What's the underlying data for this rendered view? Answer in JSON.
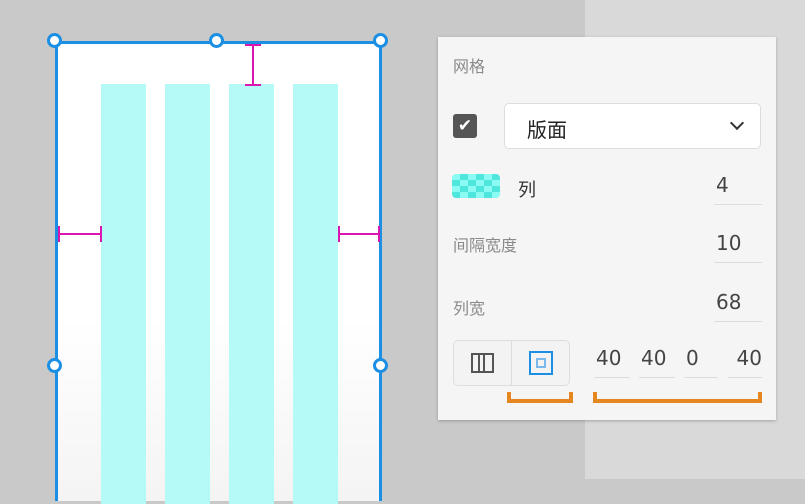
{
  "panel": {
    "title": "网格",
    "enabled": true,
    "layout_select": "版面",
    "columns_label": "列",
    "columns_value": "4",
    "gutter_label": "间隔宽度",
    "gutter_value": "10",
    "col_width_label": "列宽",
    "col_width_value": "68",
    "margins": [
      "40",
      "40",
      "0",
      "40"
    ]
  },
  "colors": {
    "selection": "#1b8fe4",
    "grid": "#b5faf6",
    "margin_marker": "#d916b0",
    "annotation": "#e6861e"
  }
}
